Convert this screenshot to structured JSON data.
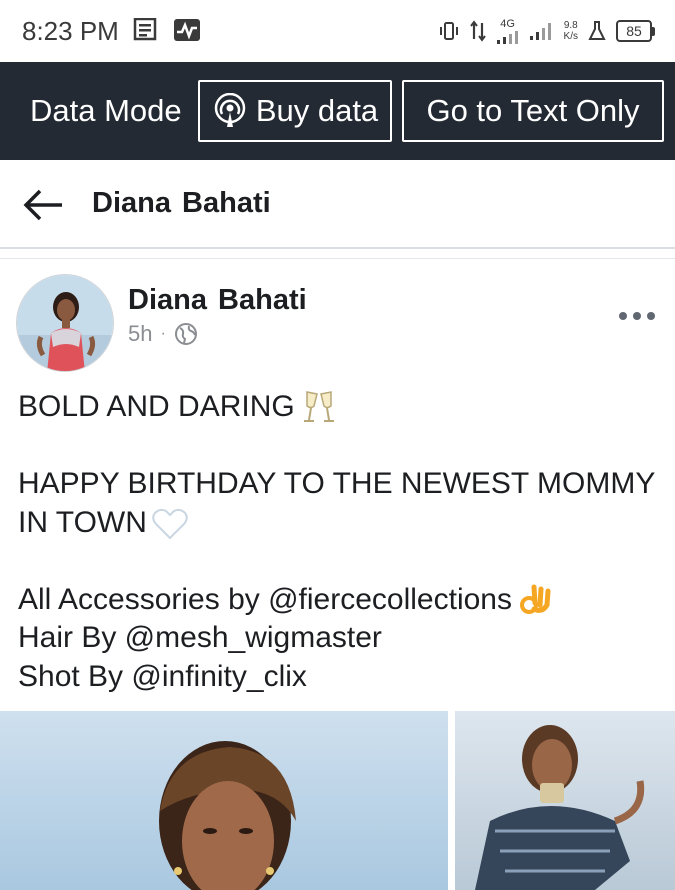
{
  "status_bar": {
    "time": "8:23 PM",
    "network_type": "4G",
    "speed_value": "9.8",
    "speed_unit": "K/s",
    "battery": "85"
  },
  "data_bar": {
    "mode_label": "Data Mode",
    "buy_data_label": "Buy data",
    "text_only_label": "Go to Text Only"
  },
  "header": {
    "title": "Diana  Bahati"
  },
  "post": {
    "author": "Diana  Bahati",
    "time_ago": "5h",
    "separator": "·",
    "privacy_icon": "globe-icon",
    "lines": {
      "line1": "BOLD AND DARING",
      "line2": "HAPPY BIRTHDAY TO THE NEWEST MOMMY",
      "line3": "IN TOWN",
      "line4": "All Accessories by @fiercecollections",
      "line5": "Hair By @mesh_wigmaster",
      "line6": "Shot By @infinity_clix"
    }
  },
  "colors": {
    "data_bar_bg": "#242a33",
    "meta_gray": "#8a8d91",
    "text": "#1c1e21"
  }
}
